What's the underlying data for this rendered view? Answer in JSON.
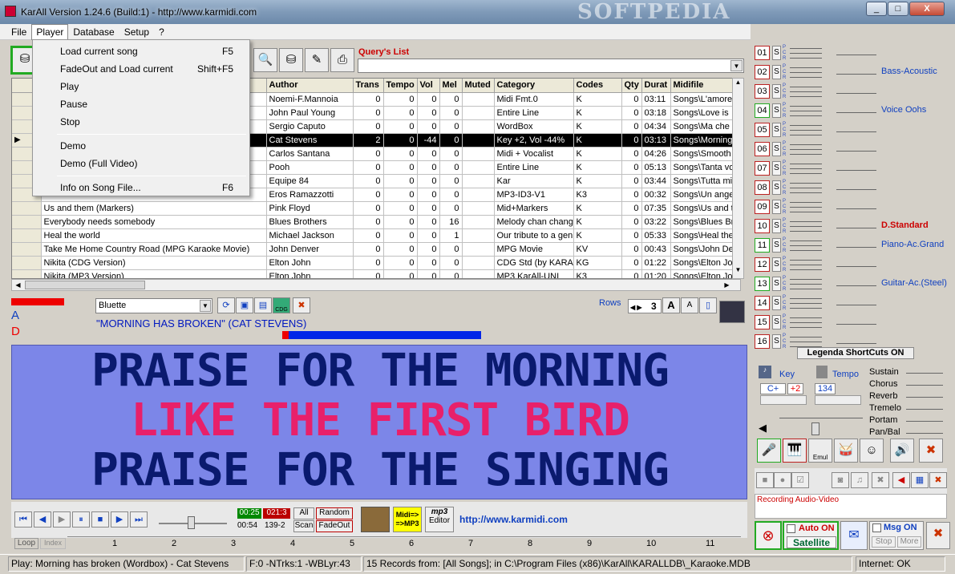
{
  "window": {
    "title": "KarAll Version 1.24.6 (Build:1) - http://www.karmidi.com",
    "watermark": "SOFTPEDIA",
    "min": "_",
    "max": "□",
    "close": "X"
  },
  "menu": [
    "File",
    "Player",
    "Database",
    "Setup",
    "?"
  ],
  "player_menu": {
    "items": [
      {
        "label": "Load current song",
        "shortcut": "F5"
      },
      {
        "label": "FadeOut and Load current",
        "shortcut": "Shift+F5"
      },
      {
        "label": "Play",
        "shortcut": ""
      },
      {
        "label": "Pause",
        "shortcut": ""
      },
      {
        "label": "Stop",
        "shortcut": ""
      },
      {
        "label": "Demo",
        "shortcut": ""
      },
      {
        "label": "Demo (Full Video)",
        "shortcut": ""
      },
      {
        "label": "Info on Song File...",
        "shortcut": "F6"
      }
    ]
  },
  "query": {
    "label": "Query's List",
    "value": ""
  },
  "grid": {
    "columns": [
      "Author",
      "Trans",
      "Tempo",
      "Vol",
      "Mel",
      "Muted",
      "Category",
      "Codes",
      "Qty",
      "Durat",
      "Midifile"
    ],
    "rows": [
      {
        "title": "",
        "author": "Noemi-F.Mannoia",
        "trans": "0",
        "tempo": "0",
        "vol": "0",
        "mel": "0",
        "muted": "",
        "category": "Midi Fmt.0",
        "codes": "K",
        "qty": "0",
        "durat": "03:11",
        "midifile": "Songs\\L'amore"
      },
      {
        "title": "",
        "author": "John Paul Young",
        "trans": "0",
        "tempo": "0",
        "vol": "0",
        "mel": "0",
        "muted": "",
        "category": "Entire Line",
        "codes": "K",
        "qty": "0",
        "durat": "03:18",
        "midifile": "Songs\\Love is"
      },
      {
        "title": "",
        "author": "Sergio Caputo",
        "trans": "0",
        "tempo": "0",
        "vol": "0",
        "mel": "0",
        "muted": "",
        "category": "WordBox",
        "codes": "K",
        "qty": "0",
        "durat": "04:34",
        "midifile": "Songs\\Ma che"
      },
      {
        "title": "",
        "author": "Cat Stevens",
        "trans": "2",
        "tempo": "0",
        "vol": "-44",
        "mel": "0",
        "muted": "",
        "category": "Key +2, Vol -44%",
        "codes": "K",
        "qty": "0",
        "durat": "03:13",
        "midifile": "Songs\\Morning"
      },
      {
        "title": "",
        "author": "Carlos Santana",
        "trans": "0",
        "tempo": "0",
        "vol": "0",
        "mel": "0",
        "muted": "",
        "category": "Midi + Vocalist",
        "codes": "K",
        "qty": "0",
        "durat": "04:26",
        "midifile": "Songs\\Smooth"
      },
      {
        "title": "",
        "author": "Pooh",
        "trans": "0",
        "tempo": "0",
        "vol": "0",
        "mel": "0",
        "muted": "",
        "category": "Entire Line",
        "codes": "K",
        "qty": "0",
        "durat": "05:13",
        "midifile": "Songs\\Tanta vo"
      },
      {
        "title": "",
        "author": "Equipe 84",
        "trans": "0",
        "tempo": "0",
        "vol": "0",
        "mel": "0",
        "muted": "",
        "category": "Kar",
        "codes": "K",
        "qty": "0",
        "durat": "03:44",
        "midifile": "Songs\\Tutta mi"
      },
      {
        "title": "",
        "author": "Eros Ramazzotti",
        "trans": "0",
        "tempo": "0",
        "vol": "0",
        "mel": "0",
        "muted": "",
        "category": "MP3-ID3-V1",
        "codes": "K3",
        "qty": "0",
        "durat": "00:32",
        "midifile": "Songs\\Un ange"
      },
      {
        "title": "Us and them (Markers)",
        "author": "Pink Floyd",
        "trans": "0",
        "tempo": "0",
        "vol": "0",
        "mel": "0",
        "muted": "",
        "category": "Mid+Markers",
        "codes": "K",
        "qty": "0",
        "durat": "07:35",
        "midifile": "Songs\\Us and t"
      },
      {
        "title": "Everybody needs somebody",
        "author": "Blues Brothers",
        "trans": "0",
        "tempo": "0",
        "vol": "0",
        "mel": "16",
        "muted": "",
        "category": "Melody chan chang",
        "codes": "K",
        "qty": "0",
        "durat": "03:22",
        "midifile": "Songs\\Blues Br"
      },
      {
        "title": "Heal the world",
        "author": "Michael Jackson",
        "trans": "0",
        "tempo": "0",
        "vol": "0",
        "mel": "1",
        "muted": "",
        "category": "Our tribute to a geni",
        "codes": "K",
        "qty": "0",
        "durat": "05:33",
        "midifile": "Songs\\Heal the"
      },
      {
        "title": "Take Me Home Country Road (MPG Karaoke Movie)",
        "author": "John Denver",
        "trans": "0",
        "tempo": "0",
        "vol": "0",
        "mel": "0",
        "muted": "",
        "category": "MPG Movie",
        "codes": "KV",
        "qty": "0",
        "durat": "00:43",
        "midifile": "Songs\\John De"
      },
      {
        "title": "Nikita (CDG Version)",
        "author": "Elton John",
        "trans": "0",
        "tempo": "0",
        "vol": "0",
        "mel": "0",
        "muted": "",
        "category": "CDG Std (by KARAI",
        "codes": "KG",
        "qty": "0",
        "durat": "01:22",
        "midifile": "Songs\\Elton Jol"
      },
      {
        "title": "Nikita (MP3 Version)",
        "author": "Elton John",
        "trans": "0",
        "tempo": "0",
        "vol": "0",
        "mel": "0",
        "muted": "",
        "category": "MP3 KarAll-UNI",
        "codes": "K3",
        "qty": "0",
        "durat": "01:20",
        "midifile": "Songs\\Elton Jol"
      }
    ]
  },
  "display": {
    "font": "Bluette",
    "rows_label": "Rows",
    "rows_value": "3",
    "cdg_label": "CDG",
    "a_label": "A",
    "d_label": "D",
    "song_title": "\"MORNING HAS BROKEN\" (CAT STEVENS)",
    "lyrics": [
      {
        "text": "PRAISE FOR THE MORNING",
        "color": "#0a1a6e"
      },
      {
        "text": "LIKE THE FIRST BIRD",
        "color": "#e8206a"
      },
      {
        "text": "PRAISE FOR THE SINGING",
        "color": "#0a1a6e"
      }
    ],
    "font_big": "A",
    "font_small": "A"
  },
  "transport": {
    "time_green": "00:25",
    "time_red": "021:3",
    "time_pos": "00:54",
    "bar_pos": "139-2",
    "all": "All",
    "random": "Random",
    "scan": "Scan",
    "fadeout": "FadeOut",
    "midi_mp3": "Midi=>\n=>MP3",
    "mp3_editor": "Editor",
    "mp3_logo": "mp3",
    "url": "http://www.karmidi.com",
    "loop": "Loop",
    "index": "Index",
    "ruler": [
      "1",
      "2",
      "3",
      "4",
      "5",
      "6",
      "7",
      "8",
      "9",
      "10",
      "11"
    ]
  },
  "channels": [
    {
      "n": "01",
      "inst": "",
      "green": false
    },
    {
      "n": "02",
      "inst": "Bass-Acoustic",
      "green": false
    },
    {
      "n": "03",
      "inst": "",
      "green": false
    },
    {
      "n": "04",
      "inst": "Voice Oohs",
      "green": true
    },
    {
      "n": "05",
      "inst": "",
      "green": false
    },
    {
      "n": "06",
      "inst": "",
      "green": false
    },
    {
      "n": "07",
      "inst": "",
      "green": false
    },
    {
      "n": "08",
      "inst": "",
      "green": false
    },
    {
      "n": "09",
      "inst": "",
      "green": false
    },
    {
      "n": "10",
      "inst": "D.Standard",
      "green": false
    },
    {
      "n": "11",
      "inst": "Piano-Ac.Grand",
      "green": true
    },
    {
      "n": "12",
      "inst": "",
      "green": false
    },
    {
      "n": "13",
      "inst": "Guitar-Ac.(Steel)",
      "green": true
    },
    {
      "n": "14",
      "inst": "",
      "green": false
    },
    {
      "n": "15",
      "inst": "",
      "green": false
    },
    {
      "n": "16",
      "inst": "",
      "green": false
    }
  ],
  "mixer": {
    "legenda": "Legenda ShortCuts ON",
    "key_label": "Key",
    "tempo_label": "Tempo",
    "key_value": "C+",
    "key_shift": "+2",
    "tempo_value": "134",
    "effects": [
      "Sustain",
      "Chorus",
      "Reverb",
      "Tremelo",
      "Portam",
      "Pan/Bal"
    ],
    "emul": "Emul",
    "recording": "Recording Audio-Video",
    "auto_on": "Auto ON",
    "satellite": "Satellite",
    "msg_on": "Msg ON",
    "stop": "Stop",
    "more": "More"
  },
  "status": {
    "play": "Play: Morning has broken (Wordbox) - Cat Stevens",
    "info": "F:0 -NTrks:1 -WBLyr:43",
    "records": "15 Records from: [All Songs]; in C:\\Program Files (x86)\\KarAll\\KARALLDB\\_Karaoke.MDB",
    "internet": "Internet: OK"
  }
}
